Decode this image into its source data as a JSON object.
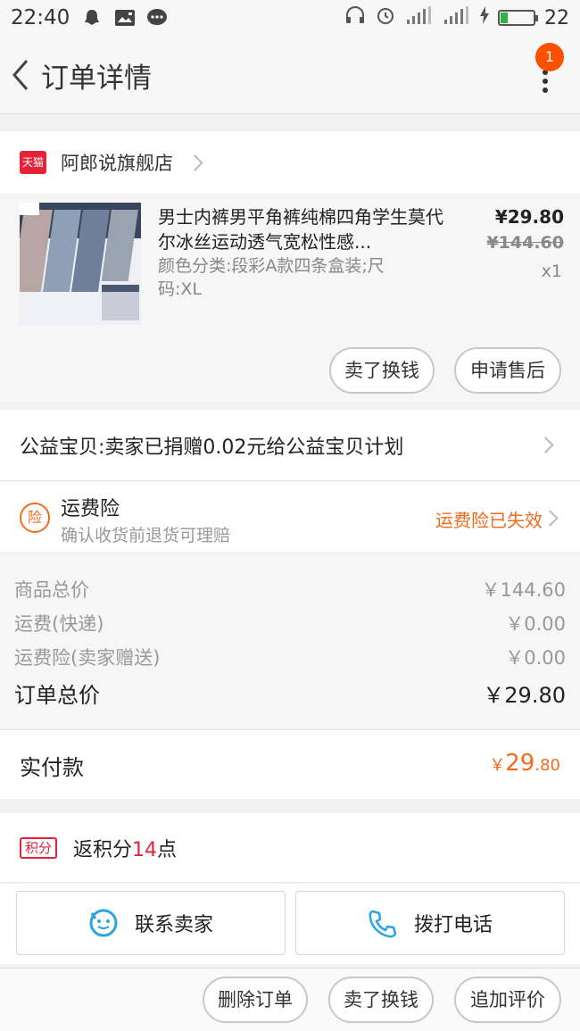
{
  "status_bar": {
    "time": "22:40",
    "battery_level": "22"
  },
  "nav": {
    "title": "订单详情",
    "notification_count": "1"
  },
  "shop": {
    "badge": "天猫",
    "name": "阿郎说旗舰店"
  },
  "item": {
    "title": "男士内裤男平角裤纯棉四角学生莫代尔冰丝运动透气宽松性感...",
    "sku": "颜色分类:段彩A款四条盒装;尺码:XL",
    "price": "¥29.80",
    "original_price": "¥144.60",
    "quantity": "x1",
    "buttons": {
      "sell": "卖了换钱",
      "after_sale": "申请售后"
    }
  },
  "charity": {
    "text": "公益宝贝:卖家已捐赠0.02元给公益宝贝计划"
  },
  "insurance": {
    "icon": "险",
    "title": "运费险",
    "subtitle": "确认收货前退货可理赔",
    "status": "运费险已失效"
  },
  "summary": {
    "rows": [
      {
        "label": "商品总价",
        "value": "￥144.60"
      },
      {
        "label": "运费(快递)",
        "value": "￥0.00"
      },
      {
        "label": "运费险(卖家赠送)",
        "value": "￥0.00"
      }
    ],
    "total_label": "订单总价",
    "total_value": "￥29.80"
  },
  "paid": {
    "label": "实付款",
    "currency": "￥",
    "integer": "29",
    "decimal": ".80"
  },
  "points": {
    "tag": "积分",
    "prefix": "返积分",
    "count": "14",
    "suffix": "点"
  },
  "actions": {
    "contact_seller": "联系卖家",
    "call": "拨打电话"
  },
  "bottom": {
    "delete": "删除订单",
    "sell": "卖了换钱",
    "review": "追加评价"
  },
  "colors": {
    "accent": "#f26b1d",
    "tmall_red": "#e4233b",
    "badge": "#ff5000"
  }
}
